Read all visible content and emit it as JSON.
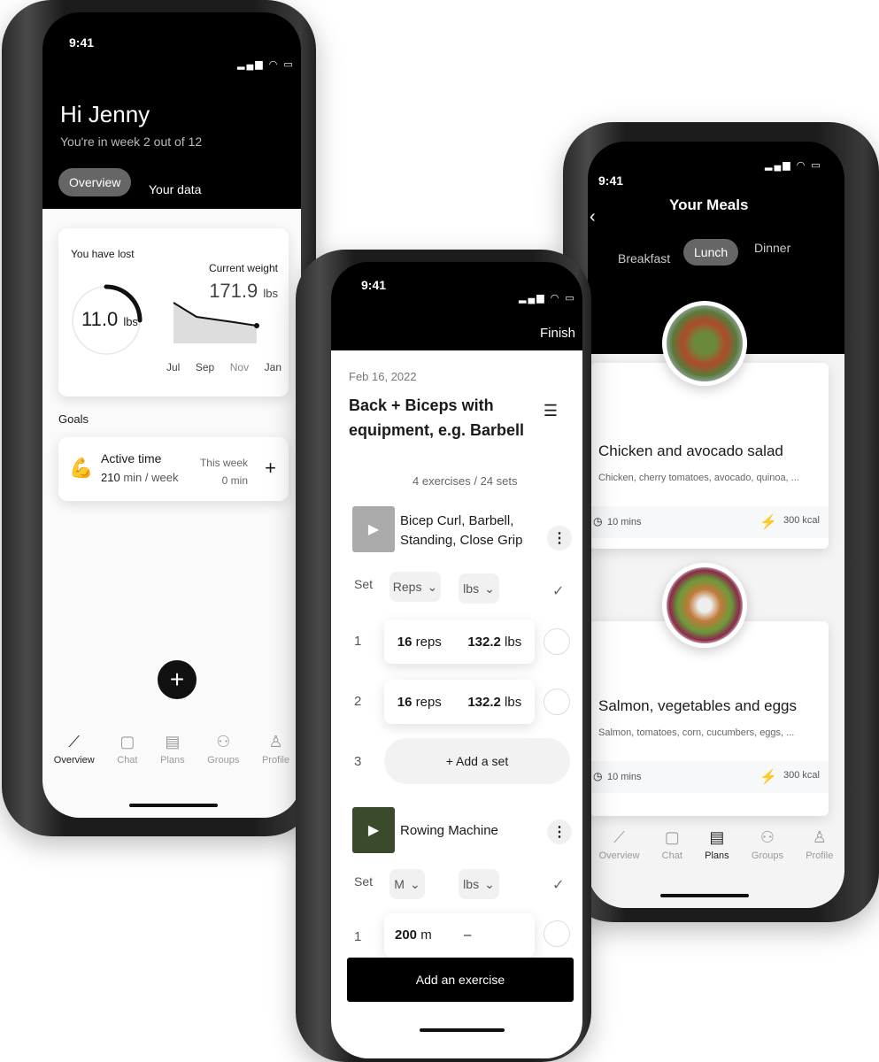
{
  "phone1": {
    "time": "9:41",
    "greeting": "Hi Jenny",
    "subtitle": "You're in week 2 out of 12",
    "tabs": [
      "Overview",
      "Your data"
    ],
    "lost_label": "You have lost",
    "lost_value": "11.0",
    "lost_unit": "lbs",
    "weight_label": "Current weight",
    "weight_value": "171.9",
    "weight_unit": "lbs",
    "months": [
      "Jul",
      "Sep",
      "Nov",
      "Jan"
    ],
    "goals_title": "Goals",
    "goal": {
      "title": "Active time",
      "target": "210",
      "target_unit": "min / week",
      "week_label": "This week",
      "week_value": "0 min"
    },
    "nav": [
      "Overview",
      "Chat",
      "Plans",
      "Groups",
      "Profile"
    ]
  },
  "phone2": {
    "time": "9:41",
    "finish": "Finish",
    "date": "Feb 16, 2022",
    "title": "Back + Biceps with equipment, e.g. Barbell",
    "summary": "4 exercises / 24 sets",
    "ex1": {
      "name": "Bicep Curl, Barbell, Standing, Close Grip",
      "set": "Set",
      "col1": "Reps",
      "col2": "lbs",
      "rows": [
        {
          "n": "1",
          "a": "16",
          "au": "reps",
          "b": "132.2",
          "bu": "lbs"
        },
        {
          "n": "2",
          "a": "16",
          "au": "reps",
          "b": "132.2",
          "bu": "lbs"
        }
      ],
      "add_n": "3",
      "add": "+ Add a set"
    },
    "ex2": {
      "name": "Rowing Machine",
      "set": "Set",
      "col1": "M",
      "col2": "lbs",
      "row": {
        "n": "1",
        "a": "200",
        "au": "m",
        "b": "–"
      }
    },
    "add_exercise": "Add an exercise"
  },
  "phone3": {
    "time": "9:41",
    "title": "Your Meals",
    "tabs": [
      "Breakfast",
      "Lunch",
      "Dinner"
    ],
    "meals": [
      {
        "name": "Chicken and avocado salad",
        "ingredients": "Chicken, cherry tomatoes, avocado, quinoa, ...",
        "time": "10 mins",
        "kcal": "300 kcal"
      },
      {
        "name": "Salmon, vegetables and eggs",
        "ingredients": "Salmon, tomatoes, corn, cucumbers, eggs, ...",
        "time": "10 mins",
        "kcal": "300 kcal"
      }
    ],
    "nav": [
      "Overview",
      "Chat",
      "Plans",
      "Groups",
      "Profile"
    ]
  }
}
